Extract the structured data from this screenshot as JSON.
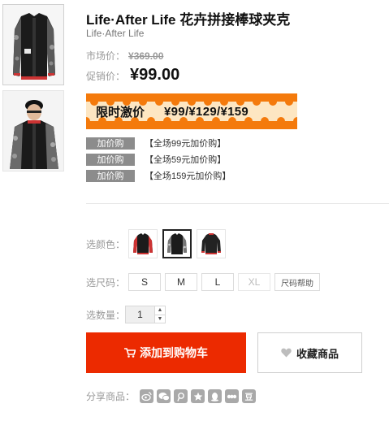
{
  "product": {
    "title": "Life·After Life 花卉拼接棒球夹克",
    "brand": "Life·After Life"
  },
  "price": {
    "market_label": "市场价：",
    "market_value": "¥369.00",
    "promo_label": "促销价：",
    "promo_value": "¥99.00"
  },
  "banner": {
    "title": "限时激价",
    "prices": "¥99/¥129/¥159",
    "colors": {
      "orange": "#f47a0c",
      "light": "#fde6c2"
    }
  },
  "addons": [
    {
      "tag": "加价购",
      "text": "【全场99元加价购】"
    },
    {
      "tag": "加价购",
      "text": "【全场59元加价购】"
    },
    {
      "tag": "加价购",
      "text": "【全场159元加价购】"
    }
  ],
  "color_select": {
    "label": "选颜色：",
    "options": [
      {
        "name": "black-red-cuff",
        "selected": false
      },
      {
        "name": "black-floral",
        "selected": true
      },
      {
        "name": "black-red-trim",
        "selected": false
      }
    ]
  },
  "size_select": {
    "label": "选尺码：",
    "options": [
      {
        "label": "S",
        "enabled": true
      },
      {
        "label": "M",
        "enabled": true
      },
      {
        "label": "L",
        "enabled": true
      },
      {
        "label": "XL",
        "enabled": false
      }
    ],
    "help_label": "尺码帮助"
  },
  "quantity": {
    "label": "选数量：",
    "value": "1"
  },
  "actions": {
    "add_to_cart": "添加到购物车",
    "favorite": "收藏商品",
    "cart_color": "#ec2a00"
  },
  "share": {
    "label": "分享商品：",
    "icons": [
      "weibo-icon",
      "wechat-icon",
      "tencent-weibo-icon",
      "qzone-icon",
      "qq-icon",
      "renren-icon",
      "douban-icon"
    ],
    "douban_glyph": "豆"
  }
}
